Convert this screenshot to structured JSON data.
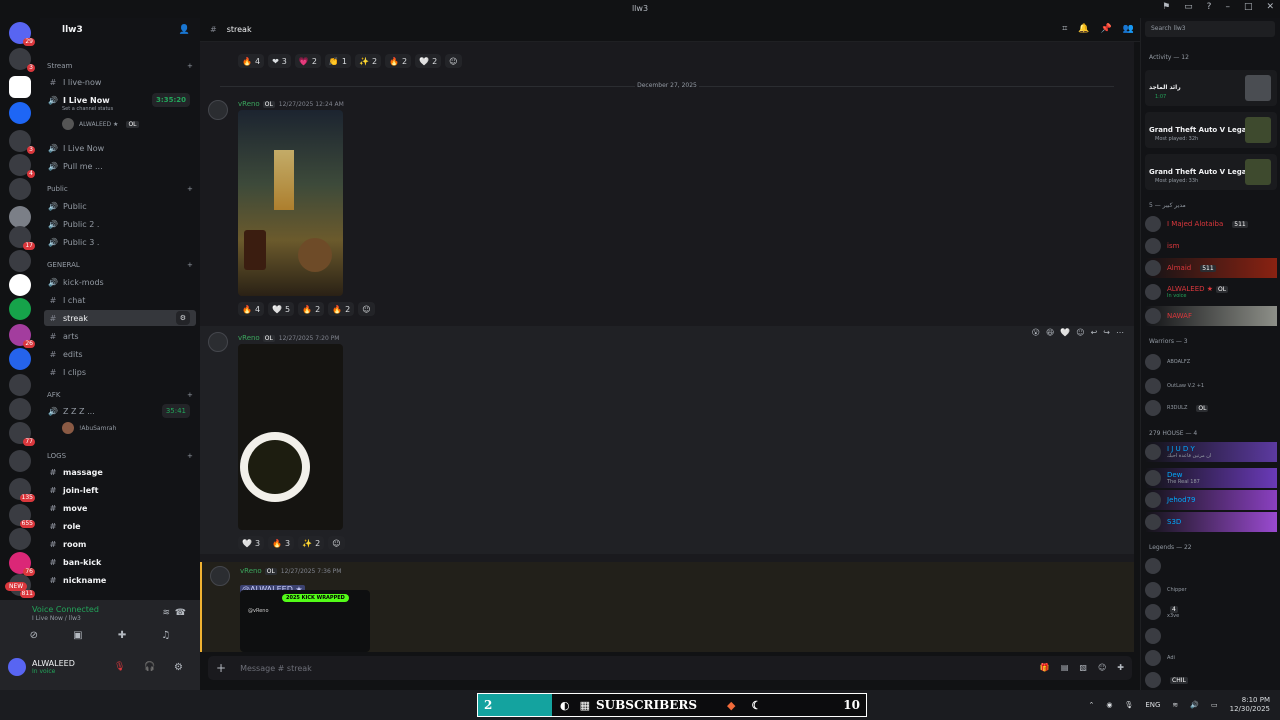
{
  "window": {
    "title": "llw3",
    "controls": [
      "⚑",
      "▭",
      "?",
      "–",
      "□",
      "✕"
    ]
  },
  "server": {
    "name": "llw3"
  },
  "server_badges": [
    "29",
    "3",
    "",
    "3",
    "4",
    "17",
    "",
    "",
    "",
    "",
    "26",
    "",
    "",
    "",
    "",
    "77",
    "",
    "135",
    "655",
    "",
    "76",
    "811"
  ],
  "channels": {
    "stream_cat": "Stream",
    "live_now": "I live-now",
    "voice_live": "I Live Now",
    "voice_live_time": "3:35:20",
    "voice_live_status": "Set a channel status",
    "voice_live_user": "ALWALEED ★",
    "voice_live_user_tag": "OL",
    "voice_live2": "I Live Now",
    "pull_me": "Pull me ...",
    "public_cat": "Public",
    "public1": "Public",
    "public2": "Public 2 .",
    "public3": "Public 3 .",
    "general_cat": "GENERAL",
    "kick_mods": "kick-mods",
    "chat": "I chat",
    "streak": "streak",
    "arts": "arts",
    "edits": "edits",
    "clips": "I clips",
    "afk_cat": "AFK",
    "zzz": "Z Z Z ...",
    "zzz_time": "35:41",
    "zzz_user": "!AbuSamrah",
    "logs_cat": "LOGS",
    "massage": "massage",
    "join_left": "join-left",
    "move": "move",
    "role": "role",
    "room": "room",
    "ban_kick": "ban-kick",
    "nickname": "nickname",
    "new_badge": "NEW"
  },
  "user_panel": {
    "voice_connected": "Voice Connected",
    "voice_where": "I Live Now / llw3",
    "name": "ALWALEED",
    "status": "In voice"
  },
  "header": {
    "channel": "streak"
  },
  "chat": {
    "date_divider": "December 27, 2025",
    "top_reactions": [
      {
        "e": "🔥",
        "n": "4"
      },
      {
        "e": "❤",
        "n": "3"
      },
      {
        "e": "💗",
        "n": "2"
      },
      {
        "e": "👏",
        "n": "1"
      },
      {
        "e": "✨",
        "n": "2"
      },
      {
        "e": "🔥",
        "n": "2"
      },
      {
        "e": "🤍",
        "n": "2"
      }
    ],
    "messages": [
      {
        "author": "vReno",
        "tag": "OL",
        "time": "12/27/2025 12:24 AM",
        "reactions": [
          {
            "e": "🔥",
            "n": "4"
          },
          {
            "e": "🤍",
            "n": "5"
          },
          {
            "e": "🔥",
            "n": "2"
          },
          {
            "e": "🔥",
            "n": "2"
          }
        ]
      },
      {
        "author": "vReno",
        "tag": "OL",
        "time": "12/27/2025 7:20 PM",
        "reactions": [
          {
            "e": "🤍",
            "n": "3"
          },
          {
            "e": "🔥",
            "n": "3"
          },
          {
            "e": "✨",
            "n": "2"
          }
        ]
      },
      {
        "author": "vReno",
        "tag": "OL",
        "time": "12/27/2025 7:36 PM",
        "mention": "@ALWALEED ★",
        "embed_label": "2025 KICK WRAPPED",
        "embed_user": "@vReno"
      }
    ]
  },
  "input": {
    "placeholder": "Message # streak"
  },
  "members": {
    "search_placeholder": "Search llw3",
    "activity_head": "Activity — 12",
    "activities": [
      {
        "title": "رائد الماجد",
        "sub": "1:07"
      },
      {
        "title": "Grand Theft Auto V Legacy",
        "sub": "Most played: 32h"
      },
      {
        "title": "Grand Theft Auto V Legacy",
        "sub": "Most played: 33h"
      }
    ],
    "group1_head": "5 — مدير كبير",
    "group1": [
      {
        "name": "I Majed Alotaiba",
        "badge": "511",
        "color": "#da373c"
      },
      {
        "name": "ism",
        "badge": "",
        "color": "#da373c"
      },
      {
        "name": "Almaid",
        "badge": "511",
        "color": "#da373c"
      },
      {
        "name": "ALWALEED ★",
        "badge": "OL",
        "sub": "In voice",
        "color": "#da373c"
      },
      {
        "name": "NAWAF",
        "badge": "",
        "color": "#da373c"
      }
    ],
    "group2_head": "Warriors — 3",
    "group2": [
      {
        "name": "ABOALFZ",
        "badge": "",
        "color": "#5865f2"
      },
      {
        "name": "OutLaw V.2 +1",
        "badge": "",
        "color": "#949ba4"
      },
      {
        "name": "R3DULZ",
        "badge": "OL",
        "color": "#5865f2"
      }
    ],
    "group3_head": "279 HOUSE — 4",
    "group3": [
      {
        "name": "I J U D Y",
        "sub": "ان مرتين قاعدة احبك",
        "color": "#00a8fc"
      },
      {
        "name": "Dew",
        "sub": "The Real 187",
        "color": "#00a8fc"
      },
      {
        "name": "Jehod79",
        "color": "#00a8fc"
      },
      {
        "name": "S3D",
        "color": "#00a8fc"
      }
    ],
    "group4_head": "Legends — 22",
    "group4": [
      {
        "name": "",
        "color": "#949ba4"
      },
      {
        "name": "Chipper",
        "color": "#949ba4"
      },
      {
        "name": "x3ve",
        "badge": "4",
        "color": "#949ba4"
      },
      {
        "name": "",
        "color": "#949ba4"
      },
      {
        "name": "Adi",
        "color": "#949ba4"
      },
      {
        "name": "CHIL",
        "color": "#949ba4"
      }
    ]
  },
  "taskbar": {
    "left_num": "2",
    "subscribers": "SUBSCRIBERS",
    "right_num": "10",
    "lang": "ENG",
    "time": "8:10 PM",
    "date": "12/30/2025"
  }
}
